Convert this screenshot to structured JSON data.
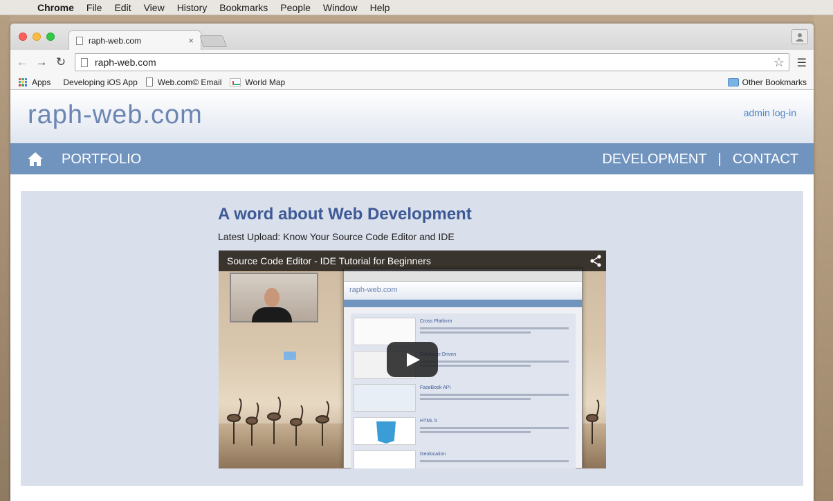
{
  "menubar": {
    "items": [
      "Chrome",
      "File",
      "Edit",
      "View",
      "History",
      "Bookmarks",
      "People",
      "Window",
      "Help"
    ]
  },
  "browser": {
    "tab_title": "raph-web.com",
    "tab_close": "×",
    "url": "raph-web.com",
    "bookmarks": [
      "Apps",
      "Developing iOS App",
      "Web.com© Email",
      "World Map"
    ],
    "other_bookmarks": "Other Bookmarks"
  },
  "site": {
    "title": "raph-web.com",
    "admin_link": "admin log-in",
    "nav": {
      "portfolio": "PORTFOLIO",
      "development": "DEVELOPMENT",
      "separator": "|",
      "contact": "CONTACT"
    }
  },
  "content": {
    "heading": "A word about Web Development",
    "latest_upload": "Latest Upload: Know Your Source Code Editor and IDE",
    "video": {
      "title": "Source Code Editor - IDE Tutorial for Beginners",
      "inner_site_title": "raph-web.com",
      "inner_items": [
        "Cross Platform",
        "Database Driven",
        "FaceBook API",
        "HTML 5",
        "Geolocation"
      ]
    }
  },
  "colors": {
    "nav_bar": "#7194bf",
    "heading": "#3d5a96",
    "content_bg": "#d9dfeb",
    "link": "#4b81c6"
  },
  "icons": [
    "apple-icon",
    "back-icon",
    "forward-icon",
    "reload-icon",
    "page-icon",
    "star-icon",
    "menu-icon",
    "apps-icon",
    "folder-icon",
    "home-icon",
    "share-icon",
    "play-icon",
    "profile-icon"
  ]
}
